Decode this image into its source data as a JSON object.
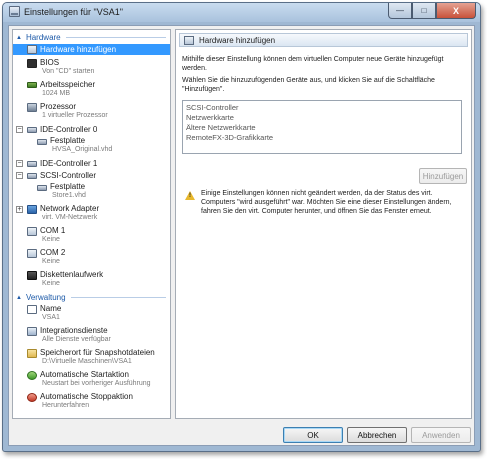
{
  "window": {
    "title": "Einstellungen für \"VSA1\"",
    "minimize_glyph": "—",
    "maximize_glyph": "□",
    "close_glyph": "X"
  },
  "tree": {
    "hardware_header": "Hardware",
    "management_header": "Verwaltung",
    "items": {
      "add_hardware": "Hardware hinzufügen",
      "bios": {
        "label": "BIOS",
        "sub": "Von \"CD\" starten"
      },
      "memory": {
        "label": "Arbeitsspeicher",
        "sub": "1024 MB"
      },
      "processor": {
        "label": "Prozessor",
        "sub": "1 virtueller Prozessor"
      },
      "ide0": {
        "label": "IDE-Controller 0"
      },
      "ide0_disk": {
        "label": "Festplatte",
        "sub": "HVSA_Original.vhd"
      },
      "ide1": {
        "label": "IDE-Controller 1"
      },
      "scsi": {
        "label": "SCSI-Controller"
      },
      "scsi_disk": {
        "label": "Festplatte",
        "sub": "Store1.vhd"
      },
      "network": {
        "label": "Network Adapter",
        "sub": "virt. VM-Netzwerk"
      },
      "com1": {
        "label": "COM 1",
        "sub": "Keine"
      },
      "com2": {
        "label": "COM 2",
        "sub": "Keine"
      },
      "floppy": {
        "label": "Diskettenlaufwerk",
        "sub": "Keine"
      },
      "name": {
        "label": "Name",
        "sub": "VSA1"
      },
      "integration": {
        "label": "Integrationsdienste",
        "sub": "Alle Dienste verfügbar"
      },
      "snapshot": {
        "label": "Speicherort für Snapshotdateien",
        "sub": "D:\\Virtuelle Maschinen\\VSA1"
      },
      "autostart": {
        "label": "Automatische Startaktion",
        "sub": "Neustart bei vorheriger Ausführung"
      },
      "autostop": {
        "label": "Automatische Stoppaktion",
        "sub": "Herunterfahren"
      }
    }
  },
  "panel": {
    "title": "Hardware hinzufügen",
    "intro": "Mithilfe dieser Einstellung können dem virtuellen Computer neue Geräte hinzugefügt werden.",
    "instruction": "Wählen Sie die hinzuzufügenden Geräte aus, und klicken Sie auf die Schaltfläche \"Hinzufügen\".",
    "devices": [
      "SCSI-Controller",
      "Netzwerkkarte",
      "Ältere Netzwerkkarte",
      "RemoteFX-3D-Grafikkarte"
    ],
    "add_button": "Hinzufügen",
    "warning": "Einige Einstellungen können nicht geändert werden, da der Status des virt. Computers \"wird ausgeführt\" war. Möchten Sie eine dieser Einstellungen ändern, fahren Sie den virt. Computer herunter, und öffnen Sie das Fenster erneut."
  },
  "footer": {
    "ok": "OK",
    "cancel": "Abbrechen",
    "apply": "Anwenden"
  }
}
